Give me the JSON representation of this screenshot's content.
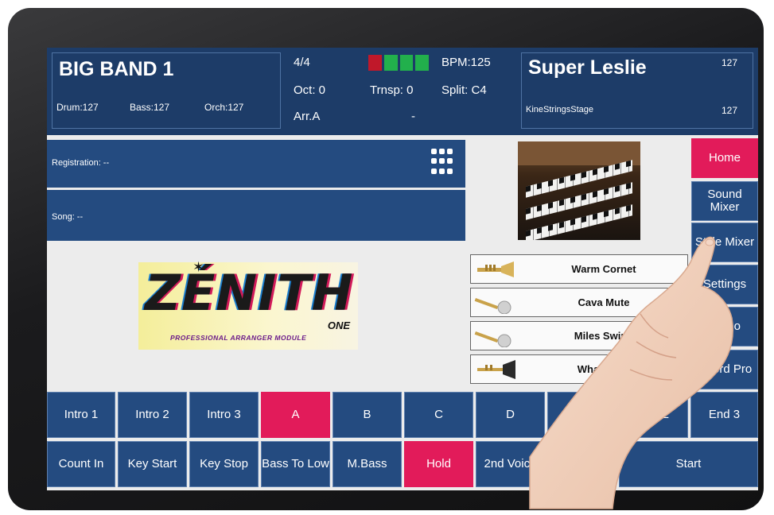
{
  "header": {
    "style_name": "BIG BAND 1",
    "drum": "Drum:127",
    "bass": "Bass:127",
    "orch": "Orch:127",
    "time_signature": "4/4",
    "octave": "Oct: 0",
    "transpose": "Trnsp: 0",
    "arrangement": "Arr.A",
    "dash": "-",
    "bpm": "BPM:125",
    "split": "Split: C4",
    "meter_colors": [
      "#c0182a",
      "#22b04c",
      "#22b04c",
      "#22b04c"
    ],
    "voice_right_name": "Super Leslie",
    "voice_right_value": "127",
    "voice_right2_name": "KineStringsStage",
    "voice_right2_value": "127"
  },
  "panels": {
    "registration": "Registration: --",
    "song": "Song: --"
  },
  "logo": {
    "title": "ZÉNITH",
    "suffix": "ONE",
    "subtitle": "PROFESSIONAL ARRANGER MODULE"
  },
  "voices": [
    {
      "name": "Warm Cornet",
      "icon": "cornet-icon"
    },
    {
      "name": "Cava Mute",
      "icon": "muted-trumpet-icon"
    },
    {
      "name": "Miles Swing",
      "icon": "muted-trumpet-icon"
    },
    {
      "name": "WhaWha T",
      "icon": "trumpet-icon"
    }
  ],
  "side_menu": {
    "home": "Home",
    "sound_mixer": "Sound Mixer",
    "style_mixer": "Style Mixer",
    "settings": "Settings",
    "demo": "Demo",
    "chord_pro": "Chord Pro"
  },
  "pads_row1": {
    "intro1": "Intro 1",
    "intro2": "Intro 2",
    "intro3": "Intro 3",
    "a": "A",
    "b": "B",
    "c": "C",
    "d": "D",
    "end1": "",
    "end2": "End 2",
    "end3": "End 3"
  },
  "pads_row2": {
    "count_in": "Count In",
    "key_start": "Key Start",
    "key_stop": "Key Stop",
    "bass_to_low": "Bass To Low",
    "mbass": "M.Bass",
    "hold": "Hold",
    "second_voice": "2nd Voice",
    "hidden": "",
    "start": "Start"
  },
  "colors": {
    "header_bg": "#1d3c68",
    "panel_bg": "#244b80",
    "active": "#e21b5a"
  }
}
